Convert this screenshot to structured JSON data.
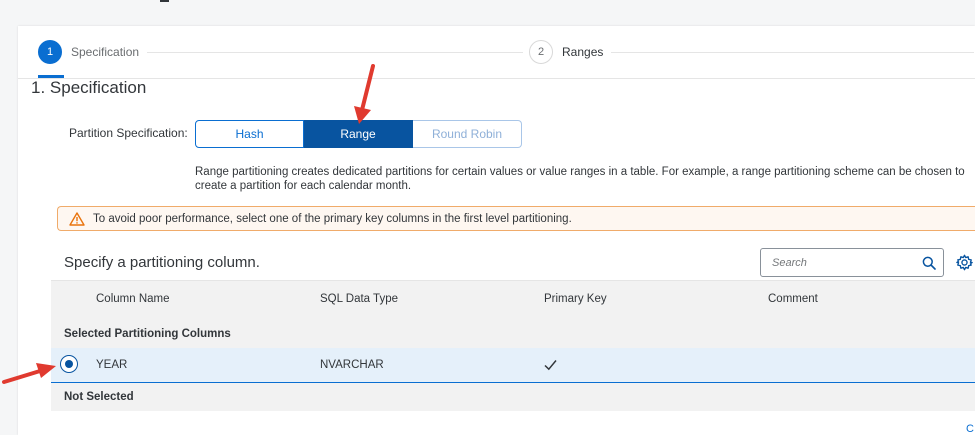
{
  "header": {
    "partial_text": ""
  },
  "wizard": {
    "steps": [
      {
        "number": "1",
        "label": "Specification"
      },
      {
        "number": "2",
        "label": "Ranges"
      }
    ]
  },
  "section_title": "1. Specification",
  "partition": {
    "label": "Partition Specification:",
    "options": [
      "Hash",
      "Range",
      "Round Robin"
    ],
    "selected": "Range"
  },
  "description": "Range partitioning creates dedicated partitions for certain values or value ranges in a table. For example, a range partitioning scheme can be chosen to create a partition for each calendar month.",
  "warning": {
    "icon": "warning-icon",
    "text": "To avoid poor performance, select one of the primary key columns in the first level partitioning."
  },
  "table": {
    "title": "Specify a partitioning column.",
    "search_placeholder": "Search",
    "columns": [
      "Column Name",
      "SQL Data Type",
      "Primary Key",
      "Comment"
    ],
    "groups": [
      {
        "label": "Selected Partitioning Columns",
        "rows": [
          {
            "name": "YEAR",
            "type": "NVARCHAR",
            "primary_key": "✓",
            "comment": "",
            "selected": true
          }
        ]
      },
      {
        "label": "Not Selected",
        "rows": []
      }
    ]
  },
  "footer": {
    "partial_text": "C"
  },
  "colors": {
    "accent": "#0a6ed1",
    "active_button": "#0854a0",
    "warning_border": "#f0ab6a",
    "warning_icon": "#e9730c",
    "annotation_arrow": "#e03a2f"
  }
}
